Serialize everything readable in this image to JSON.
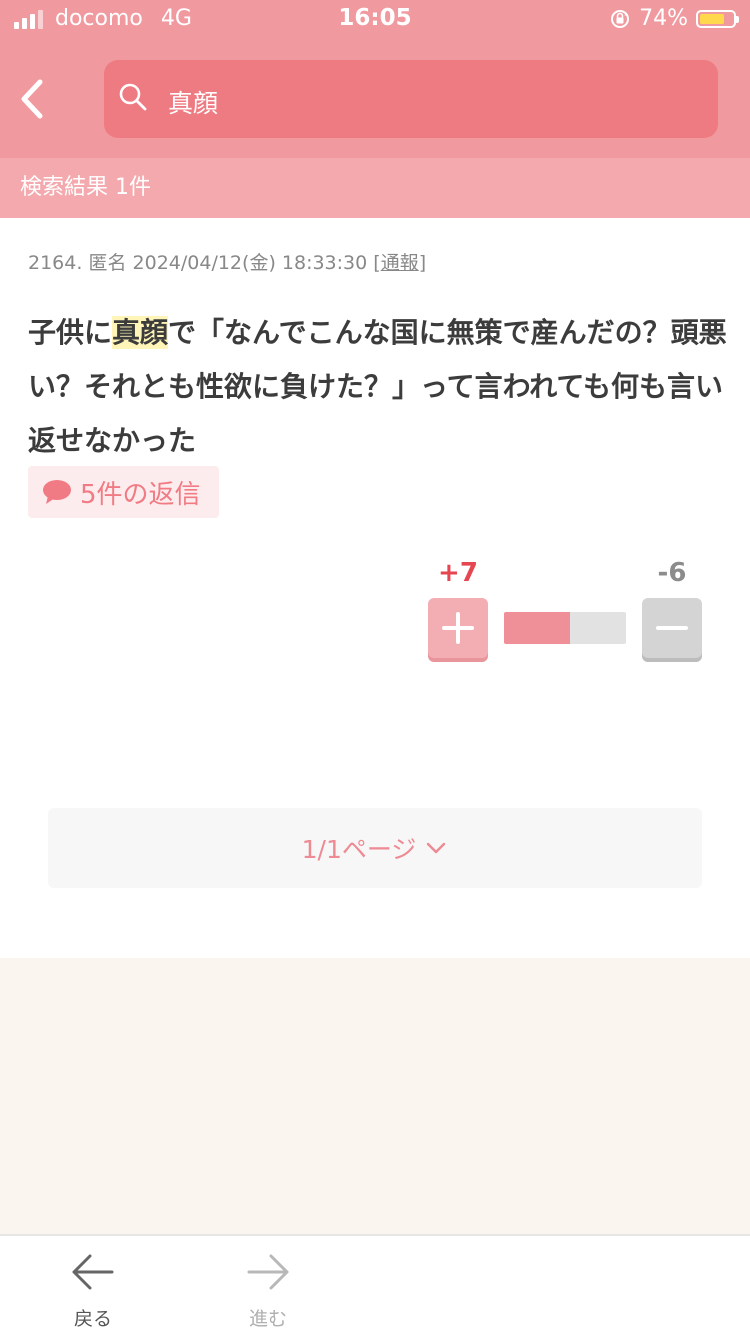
{
  "status_bar": {
    "carrier": "docomo",
    "network": "4G",
    "time": "16:05",
    "battery": "74%",
    "battery_level": 0.74,
    "battery_color": "#ffd84d"
  },
  "header": {
    "search_query": "真顔"
  },
  "results": {
    "label": "検索結果 1件"
  },
  "post": {
    "number": "2164.",
    "author": "匿名",
    "datetime": "2024/04/12(金) 18:33:30",
    "report_open": "[",
    "report_label": "通報",
    "report_close": "]",
    "body_before": "子供に",
    "body_highlight": "真顔",
    "body_after": "で「なんでこんな国に無策で産んだの？頭悪い？それとも性欲に負けた？」って言われても何も言い返せなかった",
    "reply_label": "5件の返信",
    "plus_votes": "+7",
    "minus_votes": "-6",
    "plus_ratio": 0.54
  },
  "pager": {
    "label": "1/1ページ"
  },
  "bottom_nav": {
    "back_label": "戻る",
    "forward_label": "進む"
  },
  "colors": {
    "brand": "#f09aa0",
    "search_bg": "#ee7a82",
    "accent_red": "#e6464f",
    "highlight": "#fff5b8"
  }
}
